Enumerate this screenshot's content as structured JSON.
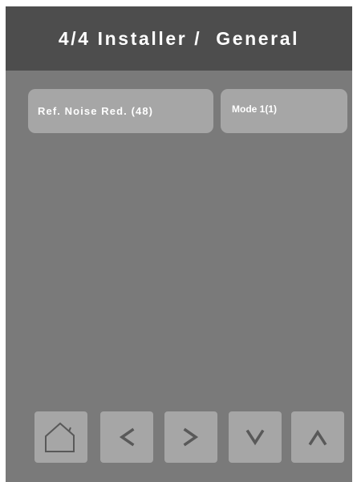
{
  "header": {
    "title": "4/4 Installer /  General"
  },
  "parameter": {
    "name": "Ref. Noise Red. (48)",
    "value": "Mode 1(1)"
  },
  "nav": {
    "icons": [
      "home-icon",
      "chevron-left-icon",
      "chevron-right-icon",
      "chevron-down-icon",
      "chevron-up-icon"
    ]
  },
  "colors": {
    "header_bg": "#4d4d4d",
    "body_bg": "#7a7a7a",
    "button_bg": "#a6a6a6",
    "icon_stroke": "#595959",
    "text": "#ffffff"
  }
}
